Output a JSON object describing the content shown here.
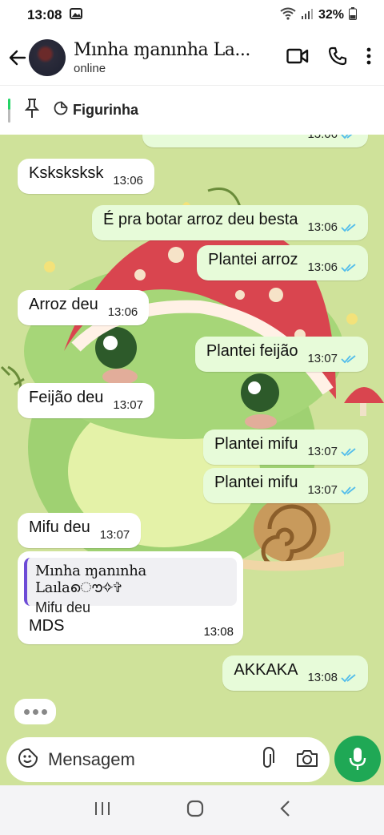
{
  "status_bar": {
    "time": "13:08",
    "battery": "32%"
  },
  "header": {
    "contact_name": "Mınha ɱanınha La...",
    "status": "online"
  },
  "pinned": {
    "label": "Figurinha"
  },
  "messages": [
    {
      "dir": "out",
      "text": "",
      "time": "13:06",
      "ticks": "read"
    },
    {
      "dir": "in",
      "text": "Ksksksksk",
      "time": "13:06"
    },
    {
      "dir": "out",
      "text": "É pra botar arroz deu besta",
      "time": "13:06",
      "ticks": "read"
    },
    {
      "dir": "out",
      "text": "Plantei arroz",
      "time": "13:06",
      "ticks": "read"
    },
    {
      "dir": "in",
      "text": "Arroz deu",
      "time": "13:06"
    },
    {
      "dir": "out",
      "text": "Plantei feijão",
      "time": "13:07",
      "ticks": "read"
    },
    {
      "dir": "in",
      "text": "Feijão deu",
      "time": "13:07"
    },
    {
      "dir": "out",
      "text": "Plantei mifu",
      "time": "13:07",
      "ticks": "read"
    },
    {
      "dir": "out",
      "text": "Plantei mifu",
      "time": "13:07",
      "ticks": "read"
    },
    {
      "dir": "in",
      "text": "Mifu deu",
      "time": "13:07"
    },
    {
      "dir": "out",
      "text": "AKKAKA",
      "time": "13:08",
      "ticks": "read"
    }
  ],
  "reply_message": {
    "quoted_name": "Mınha ɱanınha Laılaൌ✧✞",
    "quoted_text": "Mifu deu",
    "text": "MDS",
    "time": "13:08"
  },
  "composer": {
    "placeholder": "Mensagem"
  },
  "colors": {
    "accent": "#1fa855",
    "tick": "#53bdeb",
    "out_bubble": "#e7fbd9",
    "in_bubble": "#ffffff",
    "quote_bar": "#6d4bd6"
  }
}
